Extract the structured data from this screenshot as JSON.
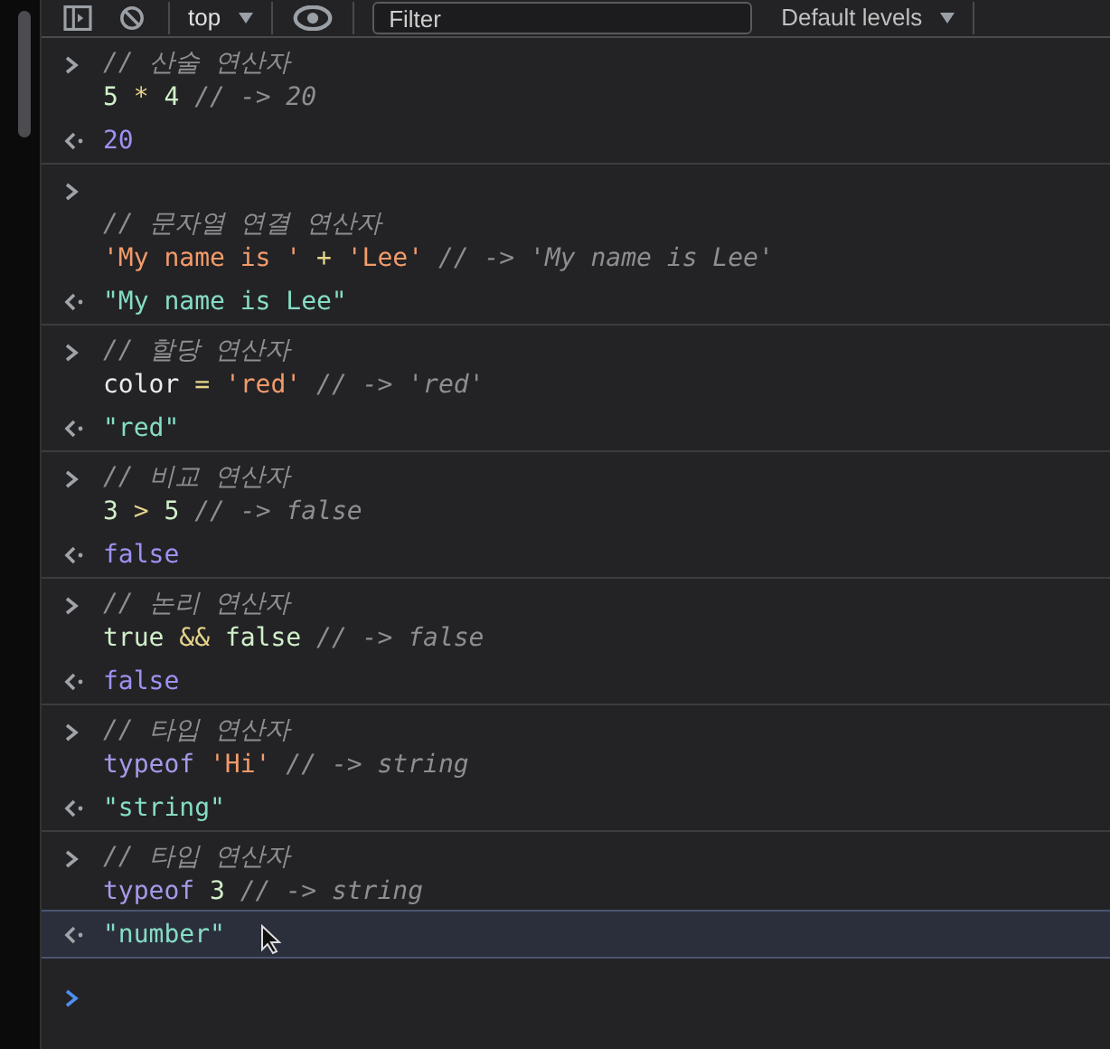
{
  "toolbar": {
    "context": "top",
    "filter": {
      "placeholder": "Filter"
    },
    "levels": "Default levels"
  },
  "entries": [
    {
      "input": [
        {
          "kind": "code",
          "tokens": [
            {
              "t": "// 산술 연산자",
              "kind": "comment"
            }
          ]
        },
        {
          "kind": "code",
          "tokens": [
            {
              "t": "5",
              "kind": "number"
            },
            {
              "t": " * ",
              "kind": "operator"
            },
            {
              "t": "4",
              "kind": "number"
            },
            {
              "t": " // -> 20",
              "kind": "comment"
            }
          ]
        }
      ],
      "result": {
        "t": "20",
        "kind": "value"
      },
      "hovered": false
    },
    {
      "input": [
        {
          "kind": "blank"
        },
        {
          "kind": "code",
          "tokens": [
            {
              "t": "// 문자열 연결 연산자",
              "kind": "comment"
            }
          ]
        },
        {
          "kind": "code",
          "tokens": [
            {
              "t": "'My name is '",
              "kind": "string"
            },
            {
              "t": " + ",
              "kind": "operator"
            },
            {
              "t": "'Lee'",
              "kind": "string"
            },
            {
              "t": " // -> 'My name is Lee'",
              "kind": "comment"
            }
          ]
        }
      ],
      "result": {
        "t": "\"My name is Lee\"",
        "kind": "string"
      },
      "hovered": false
    },
    {
      "input": [
        {
          "kind": "code",
          "tokens": [
            {
              "t": "// 할당 연산자",
              "kind": "comment"
            }
          ]
        },
        {
          "kind": "code",
          "tokens": [
            {
              "t": "color",
              "kind": "plain"
            },
            {
              "t": " = ",
              "kind": "operator"
            },
            {
              "t": "'red'",
              "kind": "string"
            },
            {
              "t": " // -> 'red'",
              "kind": "comment"
            }
          ]
        }
      ],
      "result": {
        "t": "\"red\"",
        "kind": "string"
      },
      "hovered": false
    },
    {
      "input": [
        {
          "kind": "code",
          "tokens": [
            {
              "t": "// 비교 연산자",
              "kind": "comment"
            }
          ]
        },
        {
          "kind": "code",
          "tokens": [
            {
              "t": "3",
              "kind": "number"
            },
            {
              "t": " > ",
              "kind": "operator"
            },
            {
              "t": "5",
              "kind": "number"
            },
            {
              "t": " // -> false",
              "kind": "comment"
            }
          ]
        }
      ],
      "result": {
        "t": "false",
        "kind": "value"
      },
      "hovered": false
    },
    {
      "input": [
        {
          "kind": "code",
          "tokens": [
            {
              "t": "// 논리 연산자",
              "kind": "comment"
            }
          ]
        },
        {
          "kind": "code",
          "tokens": [
            {
              "t": "true",
              "kind": "number"
            },
            {
              "t": " && ",
              "kind": "operator"
            },
            {
              "t": "false",
              "kind": "number"
            },
            {
              "t": " // -> false",
              "kind": "comment"
            }
          ]
        }
      ],
      "result": {
        "t": "false",
        "kind": "value"
      },
      "hovered": false
    },
    {
      "input": [
        {
          "kind": "code",
          "tokens": [
            {
              "t": "// 타입 연산자",
              "kind": "comment"
            }
          ]
        },
        {
          "kind": "code",
          "tokens": [
            {
              "t": "typeof",
              "kind": "keyword"
            },
            {
              "t": " 'Hi'",
              "kind": "string"
            },
            {
              "t": " // -> string",
              "kind": "comment"
            }
          ]
        }
      ],
      "result": {
        "t": "\"string\"",
        "kind": "string"
      },
      "hovered": false
    },
    {
      "input": [
        {
          "kind": "code",
          "tokens": [
            {
              "t": "// 타입 연산자",
              "kind": "comment"
            }
          ]
        },
        {
          "kind": "code",
          "tokens": [
            {
              "t": "typeof",
              "kind": "keyword"
            },
            {
              "t": " 3",
              "kind": "number"
            },
            {
              "t": " // -> string",
              "kind": "comment"
            }
          ]
        }
      ],
      "result": {
        "t": "\"number\"",
        "kind": "string"
      },
      "hovered": true
    }
  ]
}
